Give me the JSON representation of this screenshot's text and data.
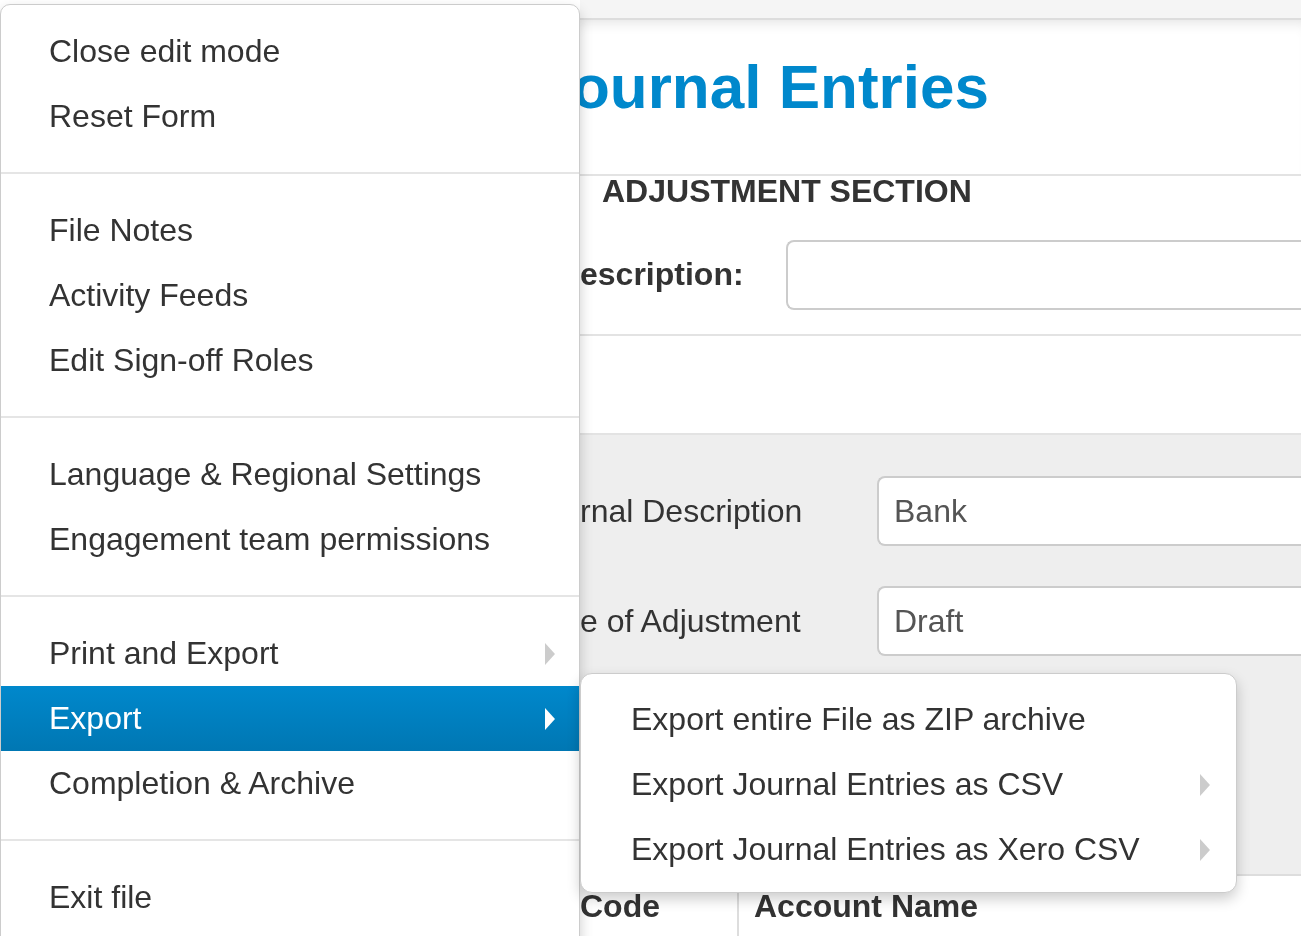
{
  "page": {
    "title": "ournal Entries",
    "section_heading": "ADJUSTMENT SECTION",
    "description_label": "escription:",
    "fields": [
      {
        "label": "rnal Description",
        "value": "Bank"
      },
      {
        "label": "e of Adjustment",
        "value": "Draft"
      }
    ],
    "table": {
      "columns": [
        "Code",
        "Account Name"
      ]
    }
  },
  "menu": {
    "groups": [
      {
        "items": [
          {
            "label": "Close edit mode",
            "selected": false,
            "has_submenu": false
          },
          {
            "label": "Reset Form",
            "selected": false,
            "has_submenu": false
          }
        ]
      },
      {
        "items": [
          {
            "label": "File Notes",
            "selected": false,
            "has_submenu": false
          },
          {
            "label": "Activity Feeds",
            "selected": false,
            "has_submenu": false
          },
          {
            "label": "Edit Sign-off Roles",
            "selected": false,
            "has_submenu": false
          }
        ]
      },
      {
        "items": [
          {
            "label": "Language & Regional Settings",
            "selected": false,
            "has_submenu": false
          },
          {
            "label": "Engagement team permissions",
            "selected": false,
            "has_submenu": false
          }
        ]
      },
      {
        "items": [
          {
            "label": "Print and Export",
            "selected": false,
            "has_submenu": true
          },
          {
            "label": "Export",
            "selected": true,
            "has_submenu": true
          },
          {
            "label": "Completion & Archive",
            "selected": false,
            "has_submenu": false
          }
        ]
      },
      {
        "items": [
          {
            "label": "Exit file",
            "selected": false,
            "has_submenu": false
          }
        ]
      }
    ]
  },
  "submenu": {
    "items": [
      {
        "label": "Export entire File as ZIP archive",
        "has_submenu": false
      },
      {
        "label": "Export Journal Entries as CSV",
        "has_submenu": true
      },
      {
        "label": "Export Journal Entries as Xero CSV",
        "has_submenu": true
      }
    ]
  }
}
